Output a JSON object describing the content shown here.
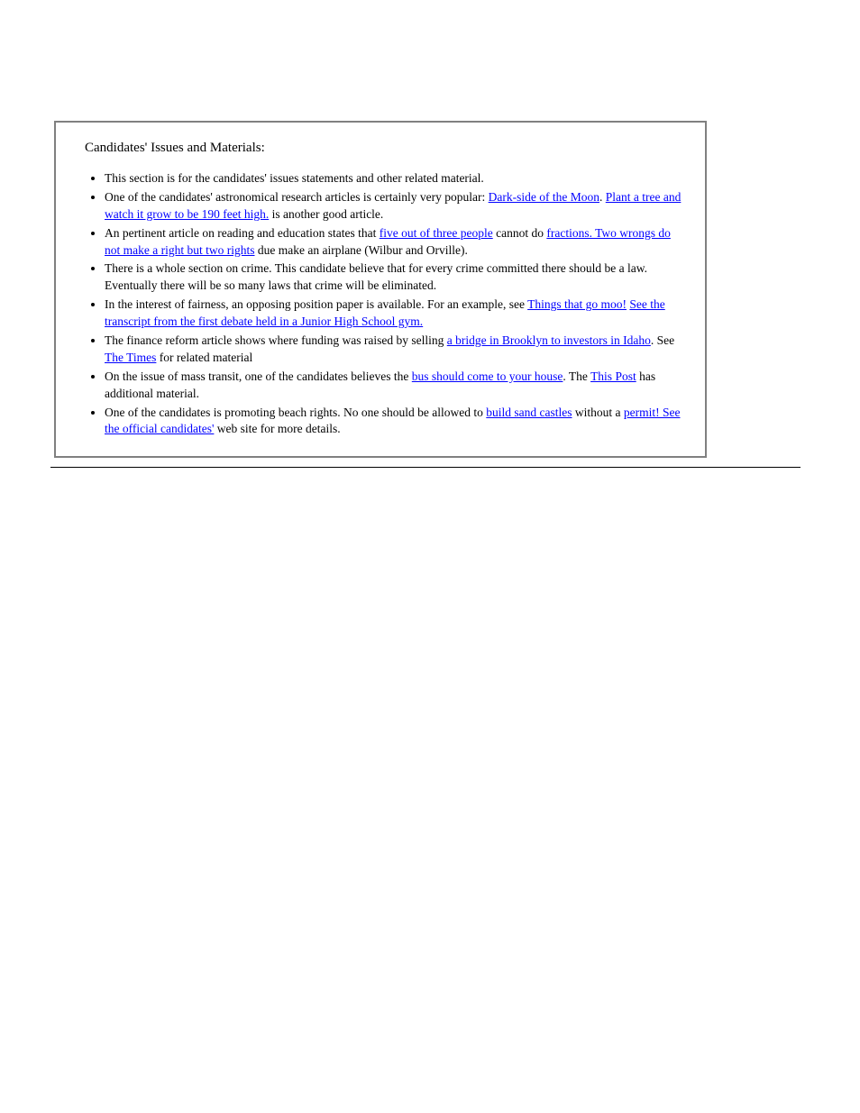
{
  "title": "Candidates' Issues and Materials:",
  "items": [
    {
      "parts": [
        {
          "text": "This section is for the candidates' issues statements and other related material."
        }
      ]
    },
    {
      "parts": [
        {
          "text": "One of the candidates' astronomical research articles is certainly very popular: "
        },
        {
          "text": "Dark-side of the Moon",
          "href": "#"
        },
        {
          "text": ". "
        },
        {
          "text": "Plant a tree and watch it grow to be 190 feet high.",
          "href": "#"
        },
        {
          "text": " is another good article."
        }
      ]
    },
    {
      "parts": [
        {
          "text": "An pertinent article on reading and education states that "
        },
        {
          "text": "five out of three people",
          "href": "#"
        },
        {
          "text": " cannot do "
        },
        {
          "text": "fractions. Two wrongs do not make a right but two rights",
          "href": "#"
        },
        {
          "text": " due make an airplane (Wilbur and Orville)."
        }
      ]
    },
    {
      "parts": [
        {
          "text": "There is a whole section on crime. This candidate believe that for every crime committed there should be a law. Eventually there will be so many laws that crime will be eliminated."
        }
      ]
    },
    {
      "parts": [
        {
          "text": "In the interest of fairness, an opposing position paper is available. For an example, see "
        },
        {
          "text": "Things that go moo!",
          "href": "#"
        },
        {
          "text": " "
        },
        {
          "text": "See the transcript from the first debate held in a Junior High School gym.",
          "href": "#"
        }
      ]
    },
    {
      "parts": [
        {
          "text": "The finance reform article shows where funding was raised by selling "
        },
        {
          "text": "a bridge in Brooklyn to investors in Idaho",
          "href": "#"
        },
        {
          "text": ". See "
        },
        {
          "text": "The Times",
          "href": "#"
        },
        {
          "text": " for related material"
        }
      ]
    },
    {
      "parts": [
        {
          "text": "On the issue of mass transit, one of the candidates believes the "
        },
        {
          "text": "bus should come to your house",
          "href": "#"
        },
        {
          "text": ". The "
        },
        {
          "text": "This Post",
          "href": "#"
        },
        {
          "text": " has additional material."
        }
      ]
    },
    {
      "parts": [
        {
          "text": "One of the candidates is promoting beach rights. No one should be allowed to "
        },
        {
          "text": "build sand castles",
          "href": "#"
        },
        {
          "text": " without a "
        },
        {
          "text": "permit! See the official candidates'",
          "href": "#"
        },
        {
          "text": " web site for more details."
        }
      ]
    }
  ]
}
